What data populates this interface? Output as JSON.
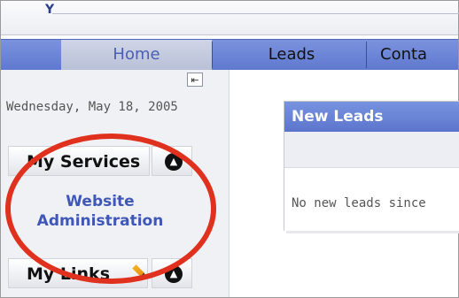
{
  "app": {
    "logo_text": "Y"
  },
  "nav": {
    "tabs": [
      {
        "label": "Home",
        "active": true
      },
      {
        "label": "Leads",
        "active": false
      },
      {
        "label": "Conta",
        "active": false
      }
    ]
  },
  "sidebar": {
    "date_text": "Wednesday, May 18, 2005",
    "my_services": {
      "title": "My Services",
      "links": [
        {
          "label": "Website Administration"
        }
      ]
    },
    "my_links": {
      "title": "My Links"
    },
    "collapse_icon": "collapse-left-icon"
  },
  "main": {
    "new_leads": {
      "title": "New Leads",
      "message": "No new leads since"
    }
  },
  "colors": {
    "nav_blue": "#5f79cf",
    "panel_blue": "#5c75cc",
    "link_blue": "#3f57b7",
    "annotation_red": "#e0301e"
  }
}
